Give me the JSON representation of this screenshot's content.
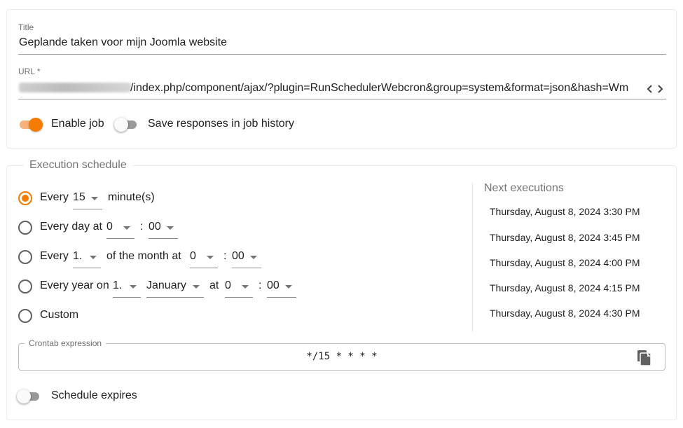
{
  "job": {
    "title_label": "Title",
    "title_value": "Geplande taken voor mijn Joomla website",
    "url_label": "URL *",
    "url_value": "/index.php/component/ajax/?plugin=RunSchedulerWebcron&group=system&format=json&hash=Wm",
    "code_icon": "code-icon",
    "enable_job_label": "Enable job",
    "enable_job_on": true,
    "save_responses_label": "Save responses in job history",
    "save_responses_on": false
  },
  "schedule": {
    "legend": "Execution schedule",
    "opt_minutes": {
      "every": "Every",
      "value": "15",
      "unit": "minute(s)",
      "selected": true
    },
    "opt_daily": {
      "label": "Every day at",
      "hour": "0",
      "colon": ":",
      "minute": "00"
    },
    "opt_monthly": {
      "every": "Every",
      "day": "1.",
      "middle": "of the month at",
      "hour": "0",
      "colon": ":",
      "minute": "00"
    },
    "opt_yearly": {
      "label": "Every year on",
      "day": "1.",
      "month": "January",
      "at": "at",
      "hour": "0",
      "colon": ":",
      "minute": "00"
    },
    "opt_custom": {
      "label": "Custom"
    },
    "crontab_label": "Crontab expression",
    "crontab_value": "*/15 * * * *",
    "copy_icon": "copy-icon",
    "expires_label": "Schedule expires",
    "expires_on": false
  },
  "next_executions": {
    "title": "Next executions",
    "items": [
      "Thursday, August 8, 2024 3:30 PM",
      "Thursday, August 8, 2024 3:45 PM",
      "Thursday, August 8, 2024 4:00 PM",
      "Thursday, August 8, 2024 4:15 PM",
      "Thursday, August 8, 2024 4:30 PM"
    ]
  },
  "colors": {
    "accent": "#f57c00",
    "accent_track": "#f6b27a",
    "text": "#212121",
    "muted": "#757575"
  }
}
